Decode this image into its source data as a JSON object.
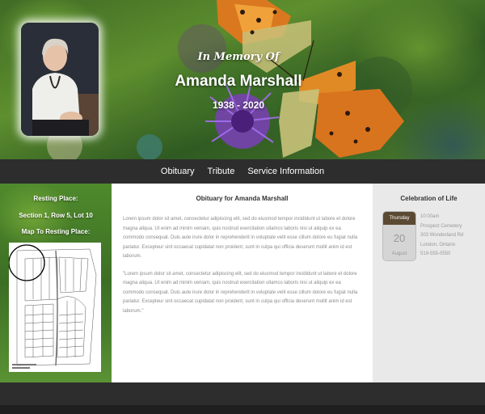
{
  "hero": {
    "in_memory": "In Memory Of",
    "name": "Amanda Marshall",
    "years": "1938 - 2020"
  },
  "nav": {
    "items": [
      {
        "label": "Obituary"
      },
      {
        "label": "Tribute"
      },
      {
        "label": "Service Information"
      }
    ]
  },
  "left": {
    "resting_label": "Resting Place:",
    "resting_value": "Section 1, Row 5, Lot 10",
    "map_label": "Map To Resting Place:"
  },
  "main": {
    "title": "Obituary for Amanda Marshall",
    "paragraph1": "Lorem ipsum dolor sit amet, consectetur adipiscing elit, sed do eiusmod tempor incididunt ut labore et dolore magna aliqua. Ut enim ad minim veniam, quis nostrud exercitation ullamco laboris nisi ut aliquip ex ea commodo consequat. Duis aute irure dolor in reprehenderit in voluptate velit esse cillum dolore eu fugiat nulla pariatur. Excepteur sint occaecat cupidatat non proident, sunt in culpa qui officia deserunt mollit anim id est laborum.",
    "paragraph2": "\"Lorem ipsum dolor sit amet, consectetur adipiscing elit, sed do eiusmod tempor incididunt ut labore et dolore magna aliqua. Ut enim ad minim veniam, quis nostrud exercitation ullamco laboris nisi ut aliquip ex ea commodo consequat. Duis aute irure dolor in reprehenderit in voluptate velit esse cillum dolore eu fugiat nulla pariatur. Excepteur sint occaecat cupidatat non proident, sunt in culpa qui officia deserunt mollit anim id est laborum.\""
  },
  "right": {
    "title": "Celebration of Life",
    "calendar": {
      "day": "Thursday",
      "date": "20",
      "month": "August"
    },
    "event": {
      "time": "10:00am",
      "venue": "Prospect Cemetery",
      "address": "303 Wonderland Rd",
      "city": "London, Ontario",
      "phone": "519-555-0550"
    }
  },
  "colors": {
    "nav_bg": "#2d2d2d",
    "calendar_header": "#5b4a33",
    "sidebar_green": "#4f8a2c"
  }
}
